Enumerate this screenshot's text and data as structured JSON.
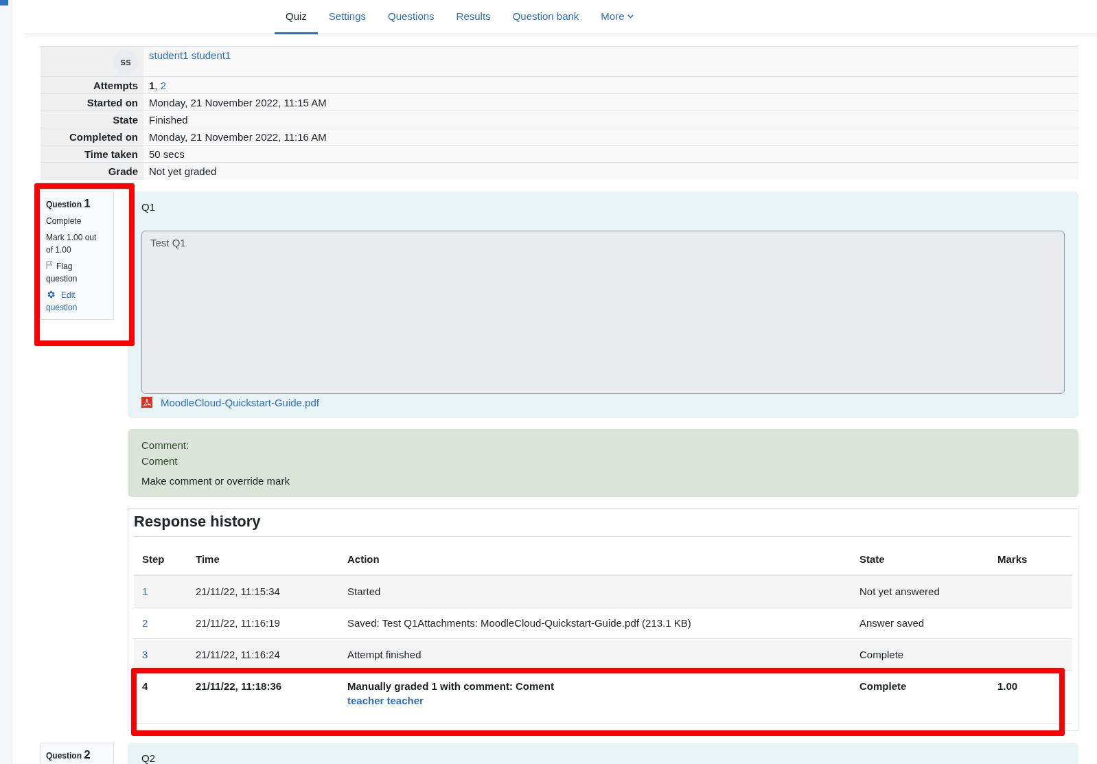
{
  "nav": {
    "tabs": [
      {
        "label": "Quiz",
        "selected": true
      },
      {
        "label": "Settings",
        "selected": false
      },
      {
        "label": "Questions",
        "selected": false
      },
      {
        "label": "Results",
        "selected": false
      },
      {
        "label": "Question bank",
        "selected": false
      },
      {
        "label": "More",
        "selected": false,
        "kind": "dropdown"
      }
    ]
  },
  "summary": {
    "user": {
      "initials": "ss",
      "name": "student1 student1"
    },
    "attempts": {
      "label": "Attempts",
      "separator": ",",
      "items": [
        {
          "text": "1",
          "selected": true
        },
        {
          "text": "2",
          "selected": false
        }
      ]
    },
    "rows": [
      {
        "label": "Started on",
        "value": "Monday, 21 November 2022, 11:15 AM"
      },
      {
        "label": "State",
        "value": "Finished"
      },
      {
        "label": "Completed on",
        "value": "Monday, 21 November 2022, 11:16 AM"
      },
      {
        "label": "Time taken",
        "value": "50 secs"
      },
      {
        "label": "Grade",
        "value": "Not yet graded"
      }
    ]
  },
  "questions": [
    {
      "label": "Question",
      "number": "1",
      "status": "Complete",
      "mark": "Mark 1.00 out of 1.00",
      "flag": "Flag question",
      "edit": "Edit question",
      "highlighted": true,
      "title": "Q1",
      "answer": "Test Q1",
      "attachment": "MoodleCloud-Quickstart-Guide.pdf",
      "comment": {
        "label": "Comment:",
        "text": "Coment",
        "link": "Make comment or override mark"
      },
      "history": {
        "title": "Response history",
        "columns": [
          "Step",
          "Time",
          "Action",
          "State",
          "Marks"
        ],
        "rows": [
          {
            "step": "1",
            "time": "21/11/22, 11:15:34",
            "action": "Started",
            "state": "Not yet answered",
            "current": false
          },
          {
            "step": "2",
            "time": "21/11/22, 11:16:19",
            "action": "Saved: Test Q1Attachments: MoodleCloud-Quickstart-Guide.pdf (213.1 KB)",
            "state": "Answer saved",
            "current": false
          },
          {
            "step": "3",
            "time": "21/11/22, 11:16:24",
            "action": "Attempt finished",
            "state": "Complete",
            "current": false
          },
          {
            "step": "4",
            "time": "21/11/22, 11:18:36",
            "action": "Manually graded 1 with comment: Coment",
            "actor": "teacher teacher",
            "state": "Complete",
            "marks": "1.00",
            "current": true,
            "highlighted": true
          }
        ]
      }
    },
    {
      "label": "Question",
      "number": "2",
      "title": "Q2"
    }
  ]
}
